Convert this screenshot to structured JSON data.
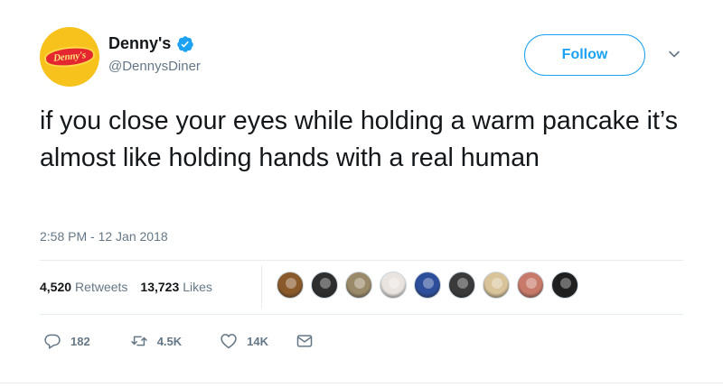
{
  "author": {
    "display_name": "Denny's",
    "handle": "@DennysDiner",
    "avatar_logo_text": "Denny's",
    "verified": true
  },
  "follow_button": {
    "label": "Follow"
  },
  "tweet": {
    "text": "if you close your eyes while holding a warm pancake it’s almost like holding hands with a real human",
    "timestamp": "2:58 PM - 12 Jan 2018"
  },
  "stats": {
    "retweets_count": "4,520",
    "retweets_label": "Retweets",
    "likes_count": "13,723",
    "likes_label": "Likes"
  },
  "likers": [
    {
      "color": "#8a5a2b"
    },
    {
      "color": "#2e2e2e"
    },
    {
      "color": "#9a8a6a"
    },
    {
      "color": "#e9e4e0"
    },
    {
      "color": "#2d4e9a"
    },
    {
      "color": "#3a3a3a"
    },
    {
      "color": "#d9c49a"
    },
    {
      "color": "#c77a6a"
    },
    {
      "color": "#1f1f1f"
    }
  ],
  "actions": {
    "reply_count": "182",
    "retweet_count": "4.5K",
    "like_count": "14K"
  },
  "colors": {
    "accent": "#1da1f2",
    "text": "#14171a",
    "secondary": "#657786",
    "denny_yellow": "#f7c21b",
    "denny_red": "#e3262f"
  }
}
